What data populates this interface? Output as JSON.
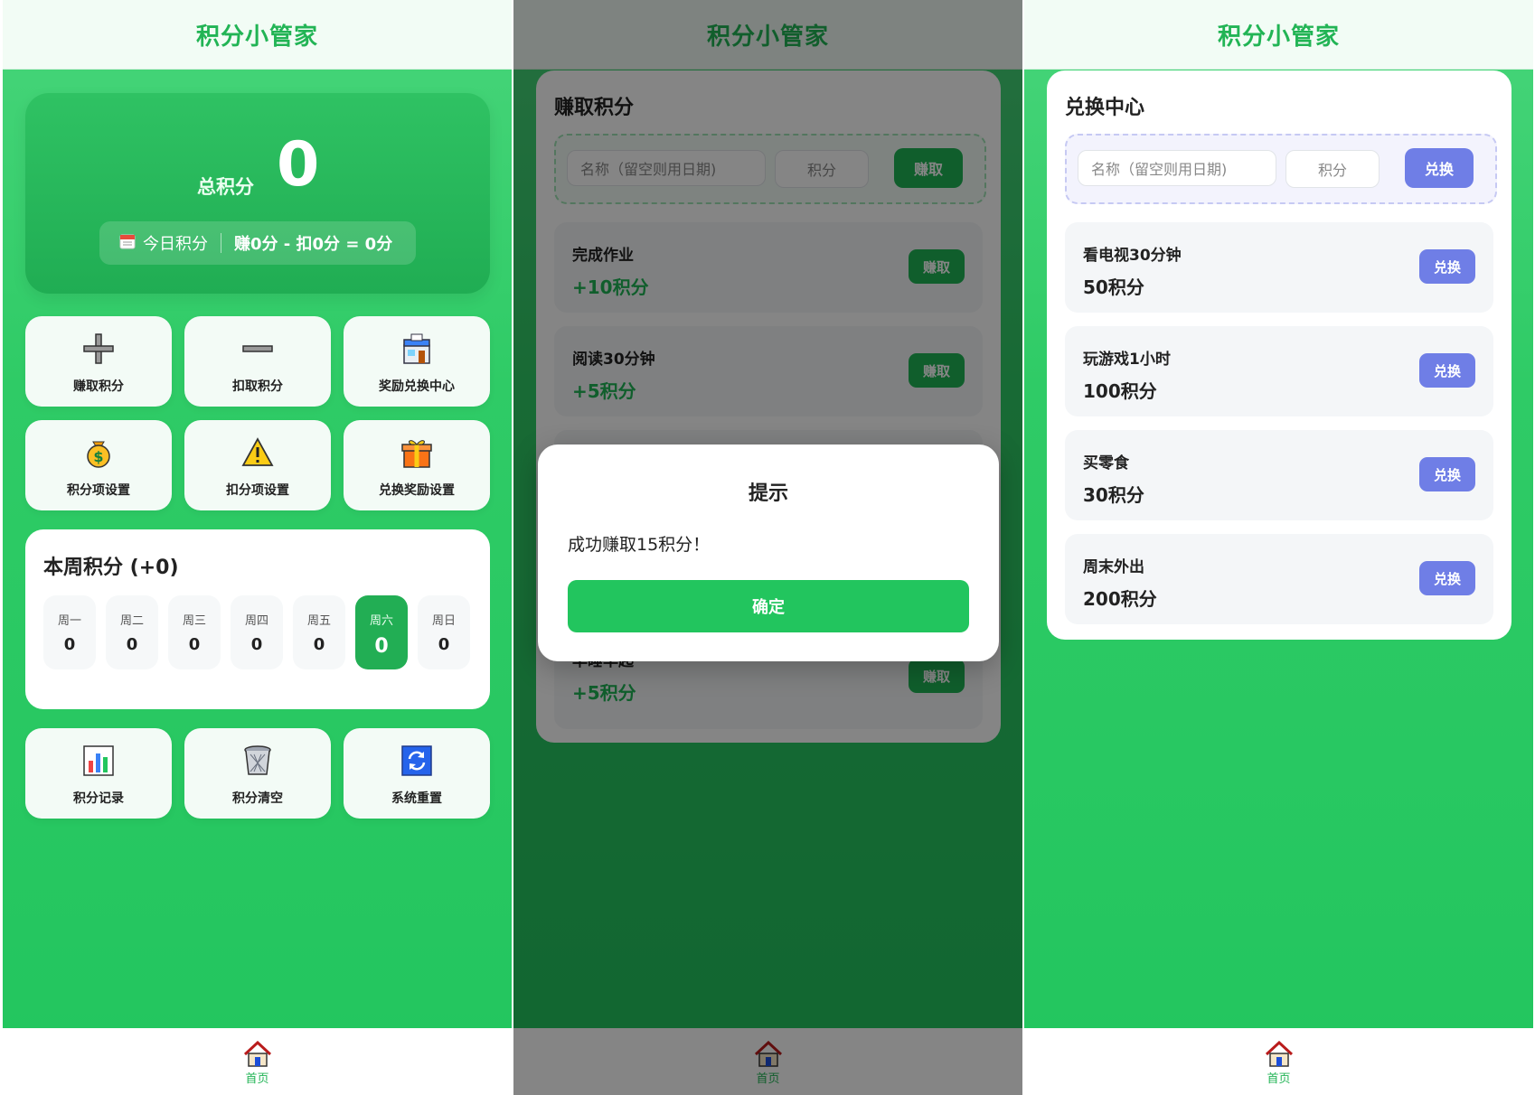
{
  "app_title": "积分小管家",
  "nav": {
    "home_label": "首页"
  },
  "home": {
    "total_label": "总积分",
    "total_value": "0",
    "today_label": "今日积分",
    "today_summary": "赚0分 - 扣0分 = 0分",
    "tiles_top": [
      {
        "label": "赚取积分",
        "icon": "plus-icon"
      },
      {
        "label": "扣取积分",
        "icon": "minus-icon"
      },
      {
        "label": "奖励兑换中心",
        "icon": "store-icon"
      },
      {
        "label": "积分项设置",
        "icon": "money-bag-icon"
      },
      {
        "label": "扣分项设置",
        "icon": "warning-icon"
      },
      {
        "label": "兑换奖励设置",
        "icon": "gift-icon"
      }
    ],
    "week": {
      "title": "本周积分 (+0)",
      "days": [
        {
          "name": "周一",
          "value": "0"
        },
        {
          "name": "周二",
          "value": "0"
        },
        {
          "name": "周三",
          "value": "0"
        },
        {
          "name": "周四",
          "value": "0"
        },
        {
          "name": "周五",
          "value": "0"
        },
        {
          "name": "周六",
          "value": "0"
        },
        {
          "name": "周日",
          "value": "0"
        }
      ],
      "active_day": "周六"
    },
    "tiles_bottom": [
      {
        "label": "积分记录",
        "icon": "bar-chart-icon"
      },
      {
        "label": "积分清空",
        "icon": "trash-icon"
      },
      {
        "label": "系统重置",
        "icon": "refresh-icon"
      }
    ]
  },
  "earn": {
    "title": "赚取积分",
    "name_placeholder": "名称（留空则用日期)",
    "points_placeholder": "积分",
    "submit_label": "赚取",
    "items": [
      {
        "name": "完成作业",
        "points": "+10积分",
        "button": "赚取"
      },
      {
        "name": "阅读30分钟",
        "points": "+5积分",
        "button": "赚取"
      },
      {
        "name": "早睡早起",
        "points": "+5积分",
        "button": "赚取"
      }
    ],
    "dialog": {
      "title": "提示",
      "message": "成功赚取15积分！",
      "confirm": "确定"
    }
  },
  "redeem": {
    "title": "兑换中心",
    "name_placeholder": "名称（留空则用日期)",
    "points_placeholder": "积分",
    "submit_label": "兑换",
    "items": [
      {
        "name": "看电视30分钟",
        "points": "50积分",
        "button": "兑换"
      },
      {
        "name": "玩游戏1小时",
        "points": "100积分",
        "button": "兑换"
      },
      {
        "name": "买零食",
        "points": "30积分",
        "button": "兑换"
      },
      {
        "name": "周末外出",
        "points": "200积分",
        "button": "兑换"
      }
    ]
  },
  "colors": {
    "brand_green": "#22c55e",
    "accent_purple": "#6f7ee6"
  }
}
